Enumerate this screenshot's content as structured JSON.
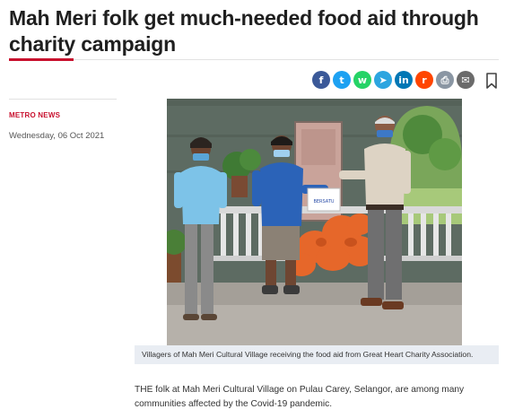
{
  "article": {
    "headline": "Mah Meri folk get much-needed food aid through charity campaign",
    "category": "METRO NEWS",
    "date": "Wednesday, 06 Oct 2021",
    "photo_caption": "Villagers of Mah Meri Cultural Village receiving the food aid from Great Heart Charity Association.",
    "body": "THE folk at Mah Meri Cultural Village on Pulau Carey, Selangor, are among many communities affected by the Covid-19 pandemic.",
    "envelope_text": "BERSATU"
  },
  "share": {
    "buttons": [
      {
        "name": "facebook-share-button",
        "icon": "facebook-icon",
        "glyph": "f",
        "color": "#3b5998"
      },
      {
        "name": "twitter-share-button",
        "icon": "twitter-icon",
        "glyph": "t",
        "color": "#1da1f2"
      },
      {
        "name": "whatsapp-share-button",
        "icon": "whatsapp-icon",
        "glyph": "w",
        "color": "#25d366"
      },
      {
        "name": "telegram-share-button",
        "icon": "telegram-icon",
        "glyph": "➤",
        "color": "#2ca5e0"
      },
      {
        "name": "linkedin-share-button",
        "icon": "linkedin-icon",
        "glyph": "in",
        "color": "#0077b5"
      },
      {
        "name": "reddit-share-button",
        "icon": "reddit-icon",
        "glyph": "r",
        "color": "#ff4500"
      },
      {
        "name": "print-button",
        "icon": "print-icon",
        "glyph": "⎙",
        "color": "#8a96a3"
      },
      {
        "name": "email-share-button",
        "icon": "email-icon",
        "glyph": "✉",
        "color": "#6b6b6b"
      }
    ],
    "bookmark_icon": "bookmark-icon"
  },
  "colors": {
    "accent": "#c8102e",
    "caption_bg": "#e9edf3"
  }
}
